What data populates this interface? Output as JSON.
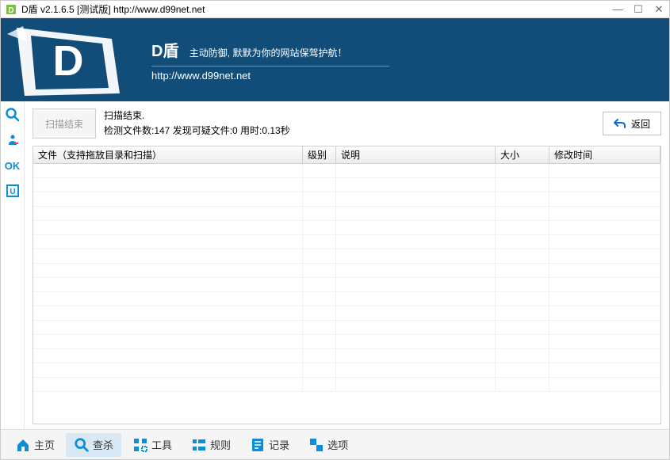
{
  "titlebar": {
    "text": "D盾 v2.1.6.5 [测试版] http://www.d99net.net"
  },
  "banner": {
    "title": "D盾",
    "subtitle": "主动防御, 默默为你的网站保驾护航！",
    "url": "http://www.d99net.net"
  },
  "action": {
    "scan_btn": "扫描结束",
    "status_line1": "扫描结束.",
    "status_line2": "检测文件数:147 发现可疑文件:0 用时:0.13秒",
    "back_btn": "返回"
  },
  "side": {
    "ok_label": "OK"
  },
  "table": {
    "headers": {
      "file": "文件（支持拖放目录和扫描）",
      "level": "级别",
      "desc": "说明",
      "size": "大小",
      "time": "修改时间"
    }
  },
  "nav": {
    "home": "主页",
    "scan": "查杀",
    "tools": "工具",
    "rules": "规则",
    "logs": "记录",
    "options": "选项"
  }
}
